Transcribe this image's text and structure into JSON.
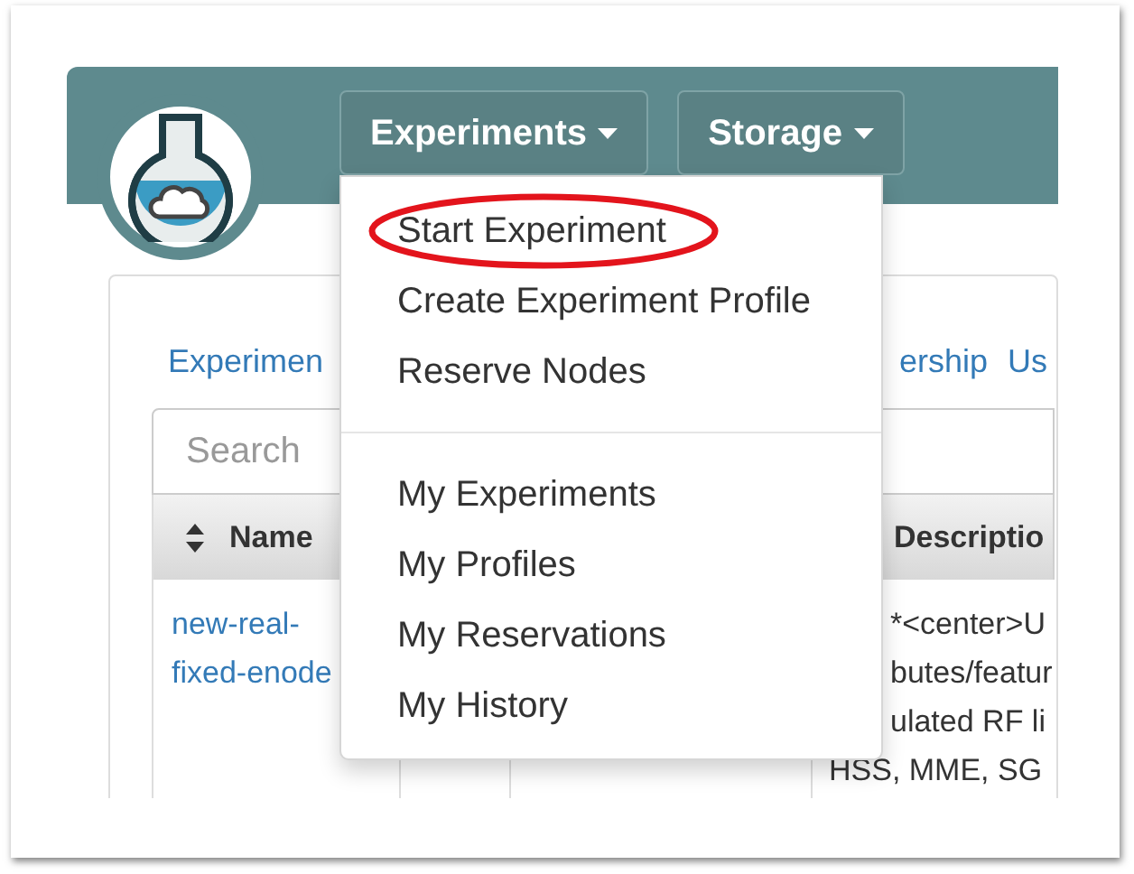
{
  "navbar": {
    "menus": [
      {
        "label": "Experiments"
      },
      {
        "label": "Storage"
      }
    ]
  },
  "dropdown": {
    "items": [
      {
        "kind": "item",
        "label": "Start Experiment",
        "circled": true
      },
      {
        "kind": "item",
        "label": "Create Experiment Profile",
        "circled": false
      },
      {
        "kind": "item",
        "label": "Reserve Nodes",
        "circled": false
      },
      {
        "kind": "divider"
      },
      {
        "kind": "item",
        "label": "My Experiments",
        "circled": false
      },
      {
        "kind": "item",
        "label": "My Profiles",
        "circled": false
      },
      {
        "kind": "item",
        "label": "My Reservations",
        "circled": false
      },
      {
        "kind": "item",
        "label": "My History",
        "circled": false
      }
    ]
  },
  "tabs": [
    {
      "label": "Experimen"
    },
    {
      "label": "ership"
    },
    {
      "label": "Us"
    }
  ],
  "search": {
    "placeholder": "Search"
  },
  "table": {
    "columns": [
      {
        "kind": "sortable",
        "label": "Name"
      },
      {
        "kind": "blank"
      },
      {
        "kind": "blank"
      },
      {
        "kind": "plain",
        "label": "Descriptio"
      }
    ],
    "rows": [
      {
        "name_lines": [
          "new-real-",
          "fixed-enode"
        ],
        "description_lines": [
          "*<center>U",
          "butes/featur",
          "ulated RF li",
          "HSS, MME, SG"
        ]
      }
    ]
  }
}
